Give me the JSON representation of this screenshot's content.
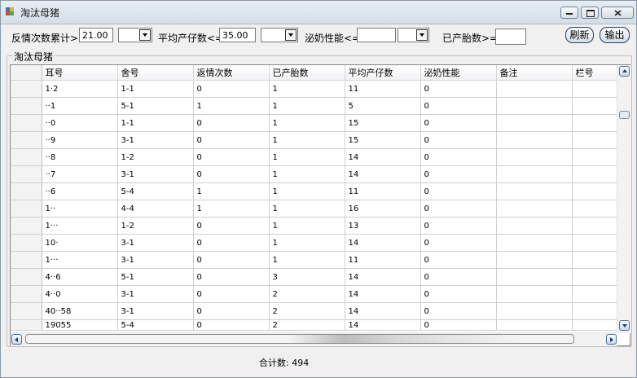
{
  "window": {
    "title": "淘汰母猪"
  },
  "icons": {
    "app": "app-icon",
    "minimize": "minimize-icon",
    "maximize": "maximize-icon",
    "close": "close-icon"
  },
  "filters": {
    "estrus_label": "反情次数累计>=",
    "estrus_value": "21.00",
    "avg_litter_label": "平均产仔数<=",
    "avg_litter_value": "35.00",
    "lactation_label": "泌奶性能<=",
    "lactation_value": "",
    "parity_label": "已产胎数>=",
    "parity_value": "",
    "refresh_label": "刷新",
    "export_label": "输出"
  },
  "group": {
    "title": "淘汰母猪"
  },
  "grid": {
    "columns": [
      "耳号",
      "舍号",
      "返情次数",
      "已产胎数",
      "平均产仔数",
      "泌奶性能",
      "备注",
      "栏号"
    ],
    "rows": [
      [
        "1·2",
        "1-1",
        "0",
        "1",
        "11",
        "0",
        "",
        ""
      ],
      [
        "··1",
        "5-1",
        "1",
        "1",
        "5",
        "0",
        "",
        ""
      ],
      [
        "··0",
        "1-1",
        "0",
        "1",
        "15",
        "0",
        "",
        ""
      ],
      [
        "··9",
        "3-1",
        "0",
        "1",
        "15",
        "0",
        "",
        ""
      ],
      [
        "··8",
        "1-2",
        "0",
        "1",
        "14",
        "0",
        "",
        ""
      ],
      [
        "··7",
        "3-1",
        "0",
        "1",
        "14",
        "0",
        "",
        ""
      ],
      [
        "··6",
        "5-4",
        "1",
        "1",
        "11",
        "0",
        "",
        ""
      ],
      [
        "1··",
        "4-4",
        "1",
        "1",
        "16",
        "0",
        "",
        ""
      ],
      [
        "1···",
        "1-2",
        "0",
        "1",
        "13",
        "0",
        "",
        ""
      ],
      [
        "10·",
        "3-1",
        "0",
        "1",
        "14",
        "0",
        "",
        ""
      ],
      [
        "1···",
        "3-1",
        "0",
        "1",
        "11",
        "0",
        "",
        ""
      ],
      [
        "4··6",
        "5-1",
        "0",
        "3",
        "14",
        "0",
        "",
        ""
      ],
      [
        "4··0",
        "3-1",
        "0",
        "2",
        "14",
        "0",
        "",
        ""
      ],
      [
        "40··58",
        "3-1",
        "0",
        "2",
        "14",
        "0",
        "",
        ""
      ],
      [
        "19055",
        "5-4",
        "0",
        "2",
        "14",
        "0",
        "",
        ""
      ]
    ]
  },
  "footer": {
    "total_label": "合计数:",
    "total_value": "494"
  }
}
